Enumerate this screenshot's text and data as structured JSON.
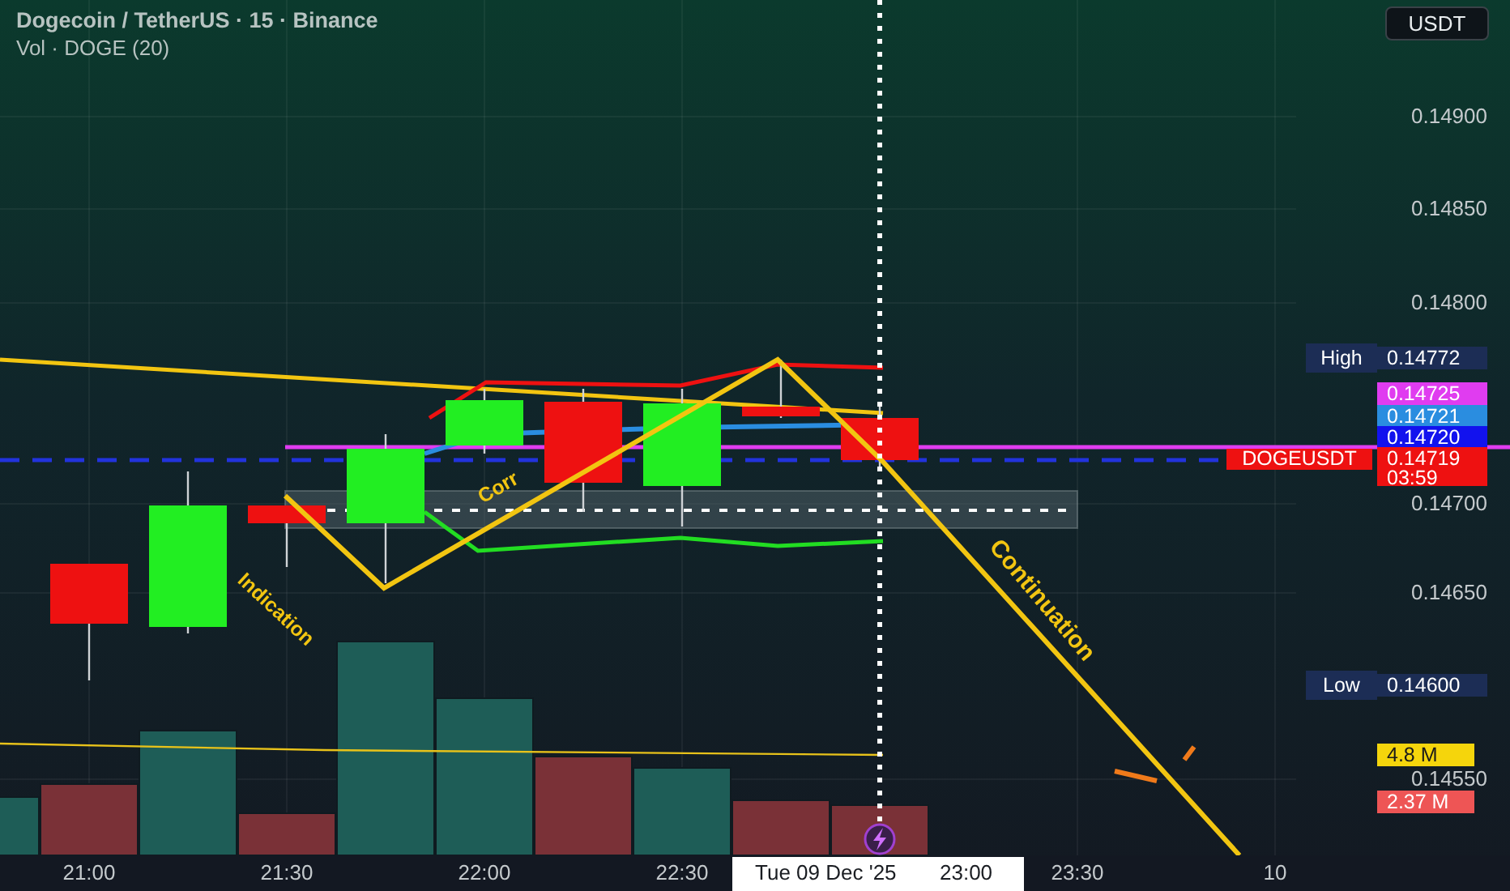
{
  "header": {
    "title": "Dogecoin / TetherUS · 15 · Binance",
    "indicator": "Vol · DOGE (20)"
  },
  "currency_button": "USDT",
  "price_axis": [
    "0.14900",
    "0.14850",
    "0.14800",
    "0.14700",
    "0.14650",
    "0.14550"
  ],
  "price_tags": [
    {
      "kind": "labeled",
      "label": "High",
      "value": "0.14772",
      "color": "#1c2d55"
    },
    {
      "kind": "plain",
      "value": "0.14725",
      "color": "#e03cf0"
    },
    {
      "kind": "plain",
      "value": "0.14721",
      "color": "#2a8de0"
    },
    {
      "kind": "plain",
      "value": "0.14720",
      "color": "#1212ee"
    },
    {
      "kind": "countdown",
      "symbol": "DOGEUSDT",
      "value": "0.14719",
      "countdown": "03:59",
      "color": "#ee1111"
    },
    {
      "kind": "labeled",
      "label": "Low",
      "value": "0.14600",
      "color": "#1c2d55"
    },
    {
      "kind": "plain",
      "value": "4.8 M",
      "color": "#f5d50c"
    },
    {
      "kind": "plain",
      "value": "2.37 M",
      "color": "#ee5555"
    }
  ],
  "annotations": [
    "Indication",
    "Corr",
    "Continuation"
  ],
  "time_axis": [
    "21:00",
    "21:30",
    "22:00",
    "22:30",
    "23:30",
    "10"
  ],
  "crosshair_time": {
    "date": "Tue 09 Dec '25",
    "time": "23:00"
  }
}
